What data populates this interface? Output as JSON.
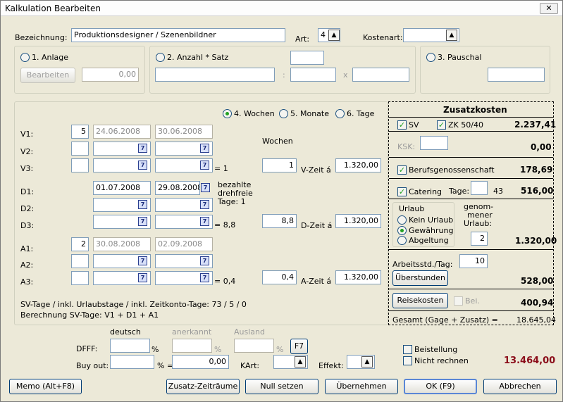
{
  "window": {
    "title": "Kalkulation Bearbeiten",
    "close": "✕"
  },
  "bezeichnung": {
    "label": "Bezeichnung:",
    "value": "Produktionsdesigner / Szenenbildner"
  },
  "art": {
    "label": "Art:",
    "value": "4"
  },
  "kostenart": {
    "label": "Kostenart:",
    "value": ""
  },
  "anlage": {
    "label": "1. Anlage",
    "button": "Bearbeiten",
    "value": "0,00"
  },
  "anzahl": {
    "label": "2. Anzahl * Satz",
    "colon": ":",
    "mult": "x"
  },
  "pauschal": {
    "label": "3. Pauschal"
  },
  "period": {
    "wochen": "4. Wochen",
    "monate": "5. Monate",
    "tage": "6. Tage",
    "selected": "wochen"
  },
  "rows": {
    "v1": {
      "label": "V1:",
      "num": "5",
      "from": "24.06.2008",
      "to": "30.06.2008"
    },
    "v2": {
      "label": "V2:"
    },
    "v3": {
      "label": "V3:",
      "eq": "= 1"
    },
    "d1": {
      "label": "D1:",
      "from": "01.07.2008",
      "to": "29.08.2008"
    },
    "d2": {
      "label": "D2:"
    },
    "d3": {
      "label": "D3:",
      "eq": "= 8,8"
    },
    "a1": {
      "label": "A1:",
      "num": "2",
      "from": "30.08.2008",
      "to": "02.09.2008"
    },
    "a2": {
      "label": "A2:"
    },
    "a3": {
      "label": "A3:",
      "eq": "= 0,4"
    }
  },
  "cal_icon": "7",
  "wochen_label": "Wochen",
  "bezahlte": {
    "l1": "bezahlte",
    "l2": "drehfreie",
    "l3": "Tage: 1"
  },
  "vzeit": {
    "count": "1",
    "label": "V-Zeit á",
    "value": "1.320,00"
  },
  "dzeit": {
    "count": "8,8",
    "label": "D-Zeit á",
    "value": "1.320,00"
  },
  "azeit": {
    "count": "0,4",
    "label": "A-Zeit á",
    "value": "1.320,00"
  },
  "sv_info": {
    "line1": "SV-Tage / inkl. Urlaubstage / inkl. Zeitkonto-Tage: 73 / 5 / 0",
    "line2": "Berechnung SV-Tage: V1 + D1 + A1"
  },
  "zusatz": {
    "title": "Zusatzkosten",
    "sv": "SV",
    "zk": "ZK 50/40",
    "sv_value": "2.237,41",
    "ksk": "KSK:",
    "ksk_value": "0,00",
    "berufs": "Berufsgenossenschaft",
    "berufs_value": "178,69",
    "catering": "Catering",
    "tage": "Tage:",
    "tage_count": "43",
    "catering_value": "516,00",
    "urlaub": "Urlaub",
    "kein": "Kein Urlaub",
    "gewaehrung": "Gewährung",
    "abgeltung": "Abgeltung",
    "genommen1": "genom-",
    "genommen2": "mener",
    "genommen3": "Urlaub:",
    "genommen_value": "2",
    "urlaub_value": "1.320,00",
    "arbeitsstd": "Arbeitsstd./Tag:",
    "arbeitsstd_value": "10",
    "ueberstunden": "Überstunden",
    "ueber_value": "528,00",
    "reisekosten": "Reisekosten",
    "bei": "Bei.",
    "reise_value": "400,94",
    "gesamt": "Gesamt (Gage + Zusatz) =",
    "gesamt_value": "18.645,04"
  },
  "dfff": {
    "label": "DFFF:",
    "deutsch": "deutsch",
    "anerkannt": "anerkannt",
    "ausland": "Ausland",
    "pct": "%",
    "f7": "F7"
  },
  "buyout": {
    "label": "Buy out:",
    "pcteq": "% =",
    "value": "0,00"
  },
  "kart": {
    "label": "KArt:"
  },
  "effekt": {
    "label": "Effekt:"
  },
  "beistellung": "Beistellung",
  "nicht_rechnen": "Nicht rechnen",
  "total": "13.464,00",
  "arrow": "▲",
  "buttons": {
    "memo": "Memo (Alt+F8)",
    "zusatz": "Zusatz-Zeiträume",
    "null": "Null setzen",
    "uebernehmen": "Übernehmen",
    "ok": "OK (F9)",
    "abbrechen": "Abbrechen"
  }
}
